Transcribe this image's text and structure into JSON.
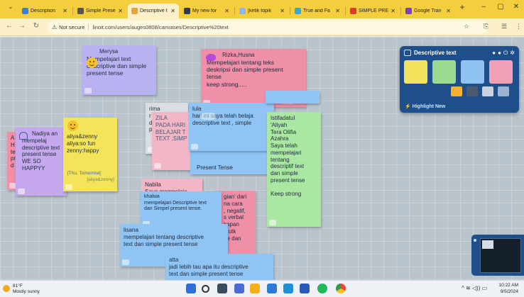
{
  "browser": {
    "tabs": [
      {
        "label": "Description",
        "color": "#3b7de0"
      },
      {
        "label": "Simple Prese",
        "color": "#555555"
      },
      {
        "label": "Descriptive t",
        "color": "#e8a23a"
      },
      {
        "label": "My new for",
        "color": "#2f3a5a"
      },
      {
        "label": "[ketik topik",
        "color": "#8fb6ea"
      },
      {
        "label": "True and Fa",
        "color": "#36a6e0"
      },
      {
        "label": "SIMPLE PRE",
        "color": "#e0392b"
      },
      {
        "label": "Google Tran",
        "color": "#7b3fc4"
      }
    ],
    "new_tab": "+",
    "controls": {
      "minimize": "–",
      "maximize": "▢",
      "close": "✕"
    },
    "address": {
      "secure_label": "Not secure",
      "url": "linoit.com/users/auges0808/canvases/Descriptive%20text"
    }
  },
  "notes": [
    {
      "author": "Merysa",
      "text": "Mempelajari text\ndescriptive dan simple\npresent tense",
      "color": "#b8b2f3"
    },
    {
      "author": "Rizka,Husna",
      "text": "Mempelajari tentang teks\ndeskripsi dan simple present\ntense\nkeep strong.....",
      "color": "#ef8fa8"
    },
    {
      "author": "rima",
      "text": "r\nd\np",
      "color": "#d9dde2"
    },
    {
      "author": "",
      "text": "ZILA\nPADA HARI\nBELAJAR T\nTEXT ,SIMP",
      "color": "#f3b6c6"
    },
    {
      "author": "lula",
      "text": "hari ini saya telah belaja\ndescriptive text , simple",
      "color": "#8fc4f5"
    },
    {
      "author": "",
      "text": "Present Tense",
      "color": "#8fc4f5"
    },
    {
      "author": "",
      "text": "Istifadatul\n'Aliyah\nTera Olifia\nAzahra\nSaya telah\nmempelajari\ntentang\n descriptif text\ndan simple\npresent tense\n\nKeep strong",
      "color": "#a9e7a2"
    },
    {
      "author": "Nadiya an",
      "text": "mempelaj\ndescriptive text\npresent tense\nWE SO HAPPYY",
      "color": "#c5a8ee"
    },
    {
      "author": "",
      "text": "aliya&zenny\naliya:so fun\nzenny:happy",
      "date": "[Thu, Tomorrow]",
      "signature": "[aliya&zenny]",
      "color": "#f5e35a"
    },
    {
      "author": "A\nH\nte\npr\nd",
      "text": "",
      "color": "#ef8fa8"
    },
    {
      "author": "Nabila",
      "text": "Saya mempelaja",
      "color": "#f3b6c6"
    },
    {
      "author": "",
      "text": "gian' dari\nna cara\n, negatif,\ns verbal\nkapan\nn utk\nbe dan",
      "color": "#ef8fa8"
    },
    {
      "author": "khalwa",
      "text": "mempelajari Descriptive text\ndan Simpel present tense.",
      "color": "#8fc4f5"
    },
    {
      "author": "lisana",
      "text": "mempelajari tentang descriptive\ntext dan simple present tense",
      "color": "#8fc4f5"
    },
    {
      "author": "atta",
      "text": "jadi lebih tau apa itu descriptive\ntext dan simple present tense",
      "color": "#8fc4f5"
    }
  ],
  "palette": {
    "title": "Descriptive text",
    "link": "Highlight New",
    "swatches": [
      "#f3e25c",
      "#9bdb8f",
      "#8ec3f2",
      "#f29fb8"
    ]
  },
  "taskbar": {
    "weather_temp": "81°F",
    "weather_desc": "Mostly sunny",
    "time": "10:22 AM",
    "date": "9/5/2024",
    "tray": "^  ≋ ◁)) ▭"
  }
}
